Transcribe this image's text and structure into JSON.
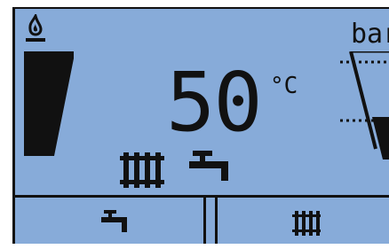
{
  "display": {
    "temperature": "50",
    "temperature_unit": "°C",
    "pressure_unit": "bar",
    "background_color": "#87abd9"
  },
  "icons": {
    "top_left": "flame-icon",
    "burner_level": "burner-level-icon",
    "pressure_gauge": "pressure-gauge-icon",
    "radiator_status": "radiator-icon",
    "hot_water_status": "tap-icon"
  },
  "buttons": [
    {
      "name": "hot-water-button",
      "icon": "tap-icon"
    },
    {
      "name": "heating-button",
      "icon": "radiator-icon"
    }
  ]
}
